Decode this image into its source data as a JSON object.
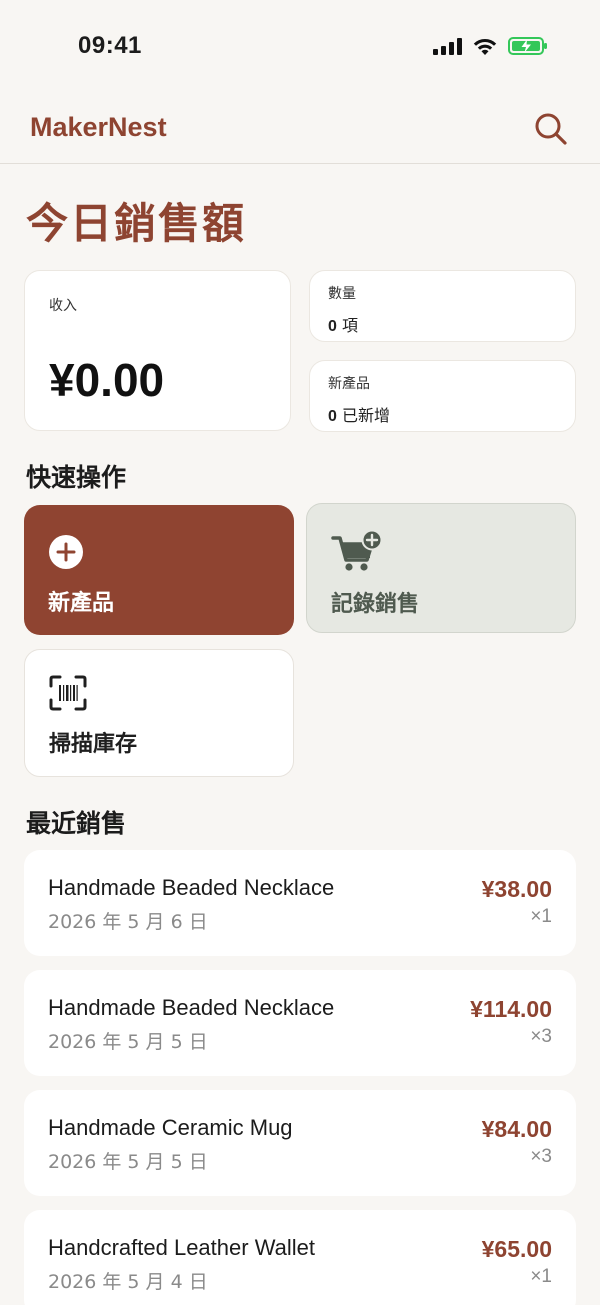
{
  "status_bar": {
    "time": "09:41"
  },
  "header": {
    "brand": "MakerNest",
    "search_icon": "search-icon"
  },
  "page_title": "今日銷售額",
  "summary": {
    "income": {
      "label": "收入",
      "value": "¥0.00"
    },
    "quantity": {
      "label": "數量",
      "count": "0",
      "unit": "項"
    },
    "new_products": {
      "label": "新產品",
      "count": "0",
      "unit": "已新增"
    }
  },
  "quick_actions": {
    "title": "快速操作",
    "new_product": {
      "label": "新產品",
      "icon": "plus-circle-icon"
    },
    "record_sale": {
      "label": "記錄銷售",
      "icon": "cart-plus-icon"
    },
    "scan_inventory": {
      "label": "掃描庫存",
      "icon": "barcode-scan-icon"
    }
  },
  "recent_sales": {
    "title": "最近銷售",
    "items": [
      {
        "name": "Handmade Beaded Necklace",
        "date": "2026 年 5 月 6 日",
        "price": "¥38.00",
        "qty": "×1"
      },
      {
        "name": "Handmade Beaded Necklace",
        "date": "2026 年 5 月 5 日",
        "price": "¥114.00",
        "qty": "×3"
      },
      {
        "name": "Handmade Ceramic Mug",
        "date": "2026 年 5 月 5 日",
        "price": "¥84.00",
        "qty": "×3"
      },
      {
        "name": "Handcrafted Leather Wallet",
        "date": "2026 年 5 月 4 日",
        "price": "¥65.00",
        "qty": "×1"
      }
    ]
  },
  "colors": {
    "brand": "#8e4431",
    "primary_tile": "#8f4431",
    "secondary_tile": "#e6e8e2",
    "background": "#f8f6f3",
    "battery": "#34c759"
  }
}
